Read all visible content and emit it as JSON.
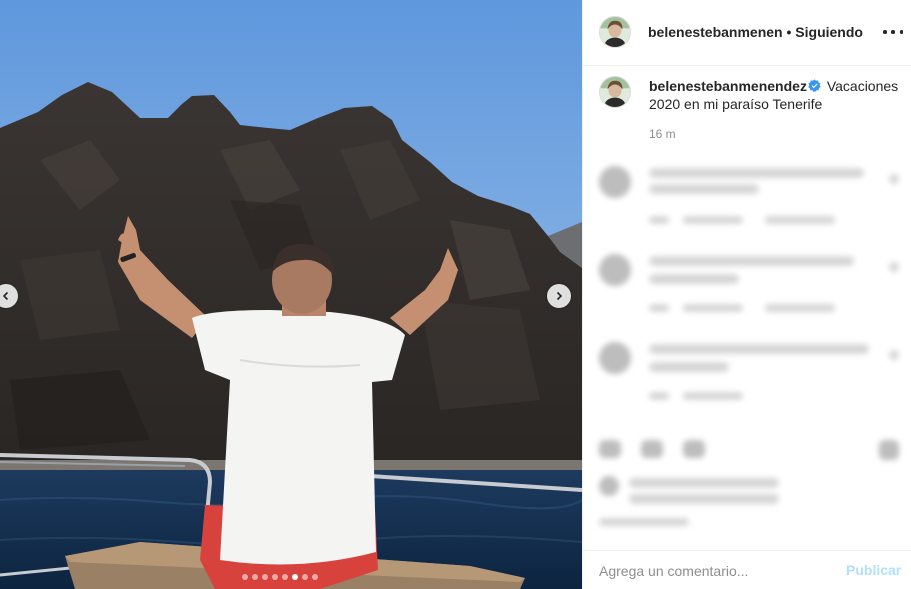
{
  "post": {
    "carousel": {
      "slide_count": 8,
      "active_index": 5,
      "prev_icon": "chevron-left-icon",
      "next_icon": "chevron-right-icon"
    }
  },
  "header": {
    "username": "belenestebanmenen",
    "separator": "•",
    "follow_label": "Siguiendo",
    "more_icon": "more-options-icon"
  },
  "caption": {
    "username": "belenestebanmenendez",
    "verified_icon": "verified-badge-icon",
    "text": "Vacaciones 2020 en mi paraíso Tenerife",
    "time": "16 m"
  },
  "comment_box": {
    "placeholder": "Agrega un comentario...",
    "post_label": "Publicar"
  },
  "colors": {
    "accent_disabled": "#b2dffc",
    "verified": "#3897f0",
    "muted": "#8e8e8e"
  }
}
